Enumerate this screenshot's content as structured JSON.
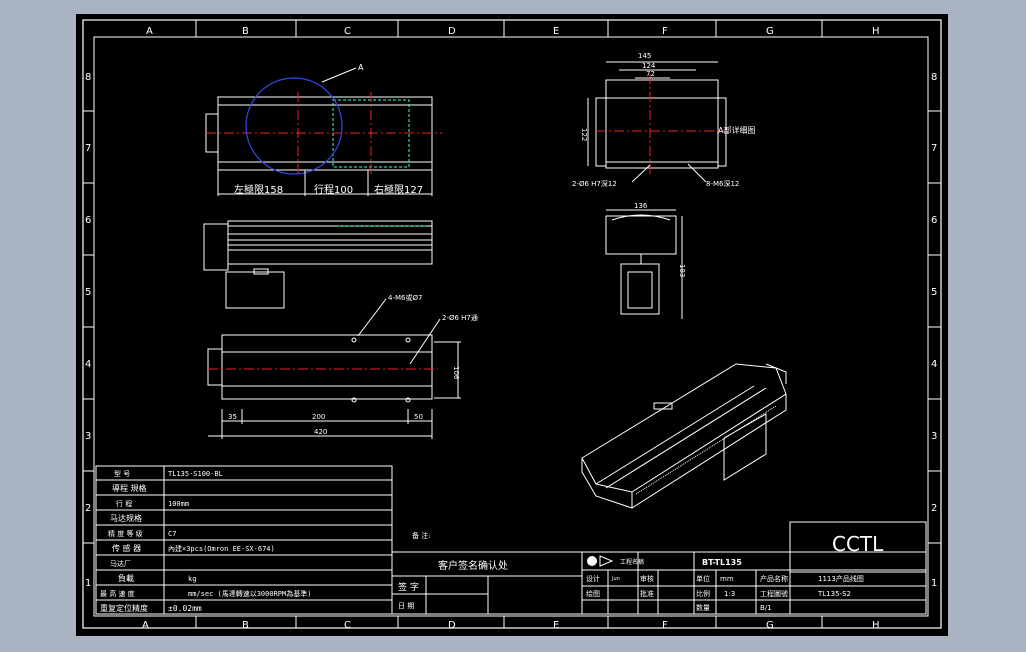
{
  "grid": {
    "columns": [
      "A",
      "B",
      "C",
      "D",
      "E",
      "F",
      "G",
      "H"
    ],
    "rows": [
      "8",
      "7",
      "6",
      "5",
      "4",
      "3",
      "2",
      "1"
    ]
  },
  "views": {
    "top_view": {
      "callout": "A",
      "dim_left": "左極限158",
      "dim_stroke": "行程100",
      "dim_right": "右極限127"
    },
    "bottom_view": {
      "hole_note_1": "4-M6或Ø7",
      "hole_note_2": "2-Ø6 H7通",
      "dim_35": "35",
      "dim_200": "200",
      "dim_50": "50",
      "dim_420": "420",
      "dim_106": "106"
    },
    "detail_a": {
      "dim_145": "145",
      "dim_124": "124",
      "dim_72": "72",
      "dim_122": "122",
      "label": "A部详细图",
      "hole_note_1": "2-Ø6 H7深12",
      "hole_note_2": "8-M6深12"
    },
    "end_view": {
      "dim_136": "136",
      "dim_183": "183"
    }
  },
  "spec_table": {
    "rows": [
      {
        "label": "型 号",
        "value": "TL135-S100-BL"
      },
      {
        "label": "導程 規格",
        "value": ""
      },
      {
        "label": "行 程",
        "value": "100mm"
      },
      {
        "label": "马达规格",
        "value": ""
      },
      {
        "label": "精 度 等 级",
        "value": "C7"
      },
      {
        "label": "传 感 器",
        "value": "內建×3pcs(Omron EE-SX-674)"
      },
      {
        "label": "马达厂",
        "value": ""
      },
      {
        "label": "負載",
        "value": "kg"
      },
      {
        "label": "最 高 速 度",
        "value": "mm/sec (馬達轉速以3000RPM為基準)"
      },
      {
        "label": "重复定位精度",
        "value": "±0.02mm"
      }
    ]
  },
  "notes": {
    "remark_label": "备 注:",
    "customer_confirm": "客户签名确认处",
    "sign_label": "签 字",
    "date_label": "日 期"
  },
  "title_block": {
    "company_name": "CCTL",
    "drawing_name": "BT-TL135",
    "project_label": "工程名稱",
    "design": "设计",
    "check": "审核",
    "approve": "批准",
    "unit_label": "单位",
    "unit_value": "mm",
    "scale_label": "比例",
    "scale_value": "1:3",
    "qty_label": "数量",
    "product_label": "产品名称",
    "product_name": "1113产品线图",
    "drawing_no_label": "工程圖號",
    "drawing_no": "TL135-S2",
    "drawn": "绘图",
    "drawn_by": "Jun",
    "date_value": "B/1"
  }
}
